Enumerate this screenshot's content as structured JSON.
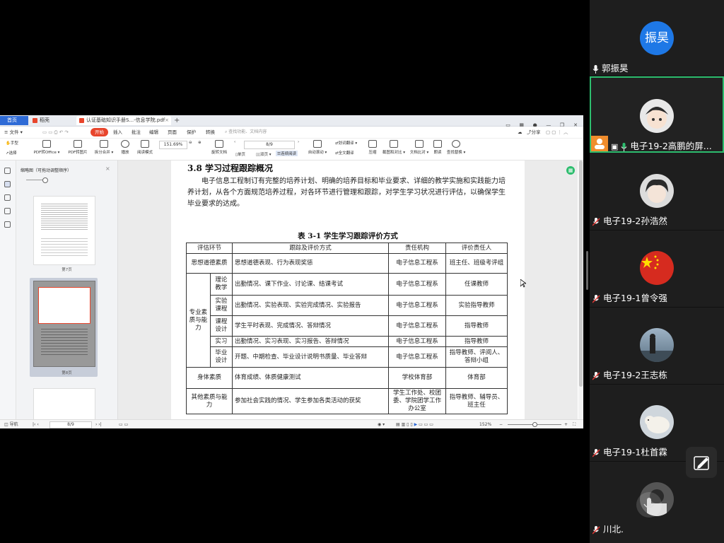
{
  "wps": {
    "tabs": [
      {
        "label": "首页"
      },
      {
        "label": "稻壳"
      },
      {
        "label": "认证基础知识手册S...-信息学院.pdf"
      }
    ],
    "menu": [
      "≡ 文件 ▾",
      "开始",
      "插入",
      "批注",
      "编辑",
      "页面",
      "保护",
      "转换"
    ],
    "search_placeholder": "查找功能、文档内容",
    "share_label": "分享",
    "toolbar": {
      "hand": "手型",
      "select": "选择",
      "pdf_office": "PDF转Office ▾",
      "pdf_image": "PDF转图片",
      "split_merge": "拆分合并 ▾",
      "play": "播放",
      "read_mode": "阅读模式",
      "zoom": "151.69%",
      "rotate": "旋转文档",
      "single": "单页",
      "double": "双页 ▾",
      "continuous": "连续阅读",
      "page_indicator": "8/9",
      "autoscroll": "自动滚动 ▾",
      "translate_line": "划词翻译 ▾",
      "translate_full": "全文翻译",
      "compress": "压缩",
      "screenshot": "截图和对比 ▾",
      "compare": "文档比对 ▾",
      "read_aloud": "朗读",
      "find_replace": "查找替换 ▾"
    },
    "thumb_title": "缩略图（可拖动调整顺序）",
    "thumb_labels": [
      "第7页",
      "第8页"
    ],
    "doc": {
      "section_title": "3.8 学习过程跟踪概况",
      "paragraph": "电子信息工程制订有完整的培养计划、明确的培养目标和毕业要求、详细的教学实施和实践能力培养计划，从各个方面规范培养过程，对各环节进行管理和跟踪，对学生学习状况进行评估，以确保学生毕业要求的达成。",
      "table_title": "表 3-1 学生学习跟踪评价方式",
      "headers": [
        "评估环节",
        "跟踪及评价方式",
        "责任机构",
        "评价责任人"
      ],
      "rows": [
        {
          "cat": "思想道德素质",
          "sub": "",
          "method": "思想道德表现、行为表现奖惩",
          "org": "电子信息工程系",
          "person": "班主任、班级考评组"
        },
        {
          "cat": "专业素质与能力",
          "sub": "理论教学",
          "method": "出勤情况、课下作业、讨论课、结课考试",
          "org": "电子信息工程系",
          "person": "任课教师"
        },
        {
          "cat": "",
          "sub": "实验课程",
          "method": "出勤情况、实验表现、实验完成情况、实验报告",
          "org": "电子信息工程系",
          "person": "实验指导教师"
        },
        {
          "cat": "",
          "sub": "课程设计",
          "method": "学生平时表现、完成情况、答辩情况",
          "org": "电子信息工程系",
          "person": "指导教师"
        },
        {
          "cat": "",
          "sub": "实习",
          "method": "出勤情况、实习表现、实习报告、答辩情况",
          "org": "电子信息工程系",
          "person": "指导教师"
        },
        {
          "cat": "",
          "sub": "毕业设计",
          "method": "开题、中期检查、毕业设计说明书质量、毕业答辩",
          "org": "电子信息工程系",
          "person": "指导教师、评阅人、答辩小组"
        },
        {
          "cat": "身体素质",
          "sub": "",
          "method": "体育成绩、体质健康测试",
          "org": "学校体育部",
          "person": "体育部"
        },
        {
          "cat": "其他素质与能力",
          "sub": "",
          "method": "参加社会实践的情况、学生参加各类活动的获奖",
          "org": "学生工作处、校团委、学院团学工作办公室",
          "person": "指导教师、辅导员、班主任"
        }
      ]
    },
    "status": {
      "nav": "导航",
      "page": "8/9",
      "zoom": "152%"
    }
  },
  "participants": [
    {
      "name": "郭振昊",
      "avatar_text": "振昊",
      "avatar_color": "#1e78e6",
      "mic": "on"
    },
    {
      "name": "电子19-2高鹏的屏...",
      "avatar_text": "",
      "avatar_color": "#e8e8e8",
      "mic": "on",
      "active": true
    },
    {
      "name": "电子19-2孙浩然",
      "avatar_text": "",
      "avatar_color": "#dcdcdc",
      "mic": "muted"
    },
    {
      "name": "电子19-1曾令强",
      "avatar_text": "",
      "avatar_color": "#d62b1f",
      "mic": "muted"
    },
    {
      "name": "电子19-2王志栋",
      "avatar_text": "",
      "avatar_color": "#8fa6b8",
      "mic": "muted"
    },
    {
      "name": "电子19-1杜首霖",
      "avatar_text": "",
      "avatar_color": "#cfd6dc",
      "mic": "muted"
    },
    {
      "name": "川北.",
      "avatar_text": "",
      "avatar_color": "#555",
      "mic": "muted"
    }
  ]
}
